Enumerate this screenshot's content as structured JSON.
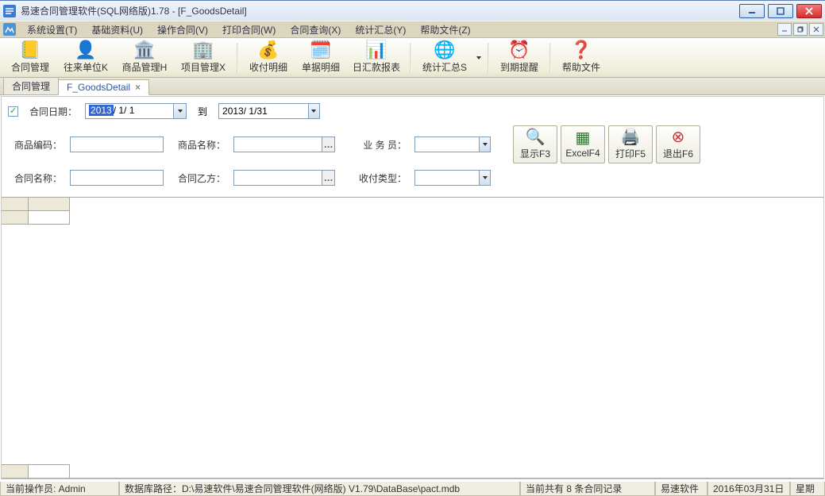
{
  "window": {
    "title": "易速合同管理软件(SQL网络版)1.78 - [F_GoodsDetail]"
  },
  "menus": [
    {
      "label": "系统设置(T)"
    },
    {
      "label": "基础资料(U)"
    },
    {
      "label": "操作合同(V)"
    },
    {
      "label": "打印合同(W)"
    },
    {
      "label": "合同查询(X)"
    },
    {
      "label": "统计汇总(Y)"
    },
    {
      "label": "帮助文件(Z)"
    }
  ],
  "toolbar": [
    {
      "label": "合同管理",
      "icon": "📒"
    },
    {
      "label": "往来单位K",
      "icon": "👤"
    },
    {
      "label": "商品管理H",
      "icon": "🏛️"
    },
    {
      "label": "项目管理X",
      "icon": "🏢"
    },
    {
      "label": "收付明细",
      "icon": "💰",
      "sep_before": true
    },
    {
      "label": "单据明细",
      "icon": "🗓️"
    },
    {
      "label": "日汇款报表",
      "icon": "📊"
    },
    {
      "label": "统计汇总S",
      "icon": "🌐",
      "sep_before": true,
      "has_dropdown": true
    },
    {
      "label": "到期提醒",
      "icon": "⏰",
      "sep_before": true
    },
    {
      "label": "帮助文件",
      "icon": "❓",
      "sep_before": true
    }
  ],
  "tabs": [
    {
      "label": "合同管理",
      "active": false
    },
    {
      "label": "F_GoodsDetail",
      "active": true,
      "closable": true
    }
  ],
  "filter": {
    "date_check_label": "合同日期：",
    "date_from_sel": "2013",
    "date_from_rest": "/ 1/ 1",
    "date_to_label": "到",
    "date_to": "2013/ 1/31",
    "goods_code_label": "商品编码：",
    "goods_code": "",
    "goods_name_label": "商品名称：",
    "goods_name": "",
    "clerk_label": "业 务 员：",
    "clerk": "",
    "contract_name_label": "合同名称：",
    "contract_name": "",
    "party_b_label": "合同乙方：",
    "party_b": "",
    "type_label": "收付类型：",
    "type": ""
  },
  "buttons": {
    "show": "显示F3",
    "excel": "ExcelF4",
    "print": "打印F5",
    "exit": "退出F6"
  },
  "status": {
    "operator": "当前操作员: Admin",
    "dbpath": "数据库路径：D:\\易速软件\\易速合同管理软件(网络版) V1.79\\DataBase\\pact.mdb",
    "count": "当前共有 8 条合同记录",
    "brand": "易速软件",
    "date": "2016年03月31日",
    "weekday": "星期"
  }
}
